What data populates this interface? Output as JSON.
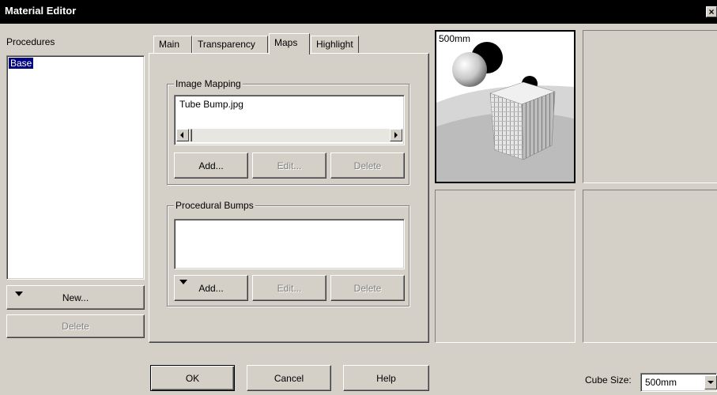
{
  "window": {
    "title": "Material Editor",
    "close_glyph": "×"
  },
  "procedures": {
    "label": "Procedures",
    "items": [
      "Base"
    ],
    "selected": "Base",
    "new_label": "New...",
    "delete_label": "Delete"
  },
  "tabs": [
    {
      "label": "Main",
      "active": false
    },
    {
      "label": "Transparency",
      "active": false
    },
    {
      "label": "Maps",
      "active": true
    },
    {
      "label": "Highlight",
      "active": false
    }
  ],
  "image_mapping": {
    "legend": "Image Mapping",
    "items": [
      "Tube Bump.jpg"
    ],
    "add_label": "Add...",
    "edit_label": "Edit...",
    "delete_label": "Delete"
  },
  "procedural_bumps": {
    "legend": "Procedural Bumps",
    "items": [],
    "add_label": "Add...",
    "edit_label": "Edit...",
    "delete_label": "Delete"
  },
  "footer": {
    "ok_label": "OK",
    "cancel_label": "Cancel",
    "help_label": "Help",
    "cube_size_label": "Cube Size:",
    "cube_size_value": "500mm"
  },
  "previews": [
    {
      "caption": "500mm",
      "selected": true
    },
    {
      "caption": "",
      "selected": false
    },
    {
      "caption": "",
      "selected": false
    },
    {
      "caption": "",
      "selected": false
    }
  ],
  "colors": {
    "dialog_bg": "#d4d0c8",
    "title_bg": "#000000",
    "selection": "#000080"
  }
}
